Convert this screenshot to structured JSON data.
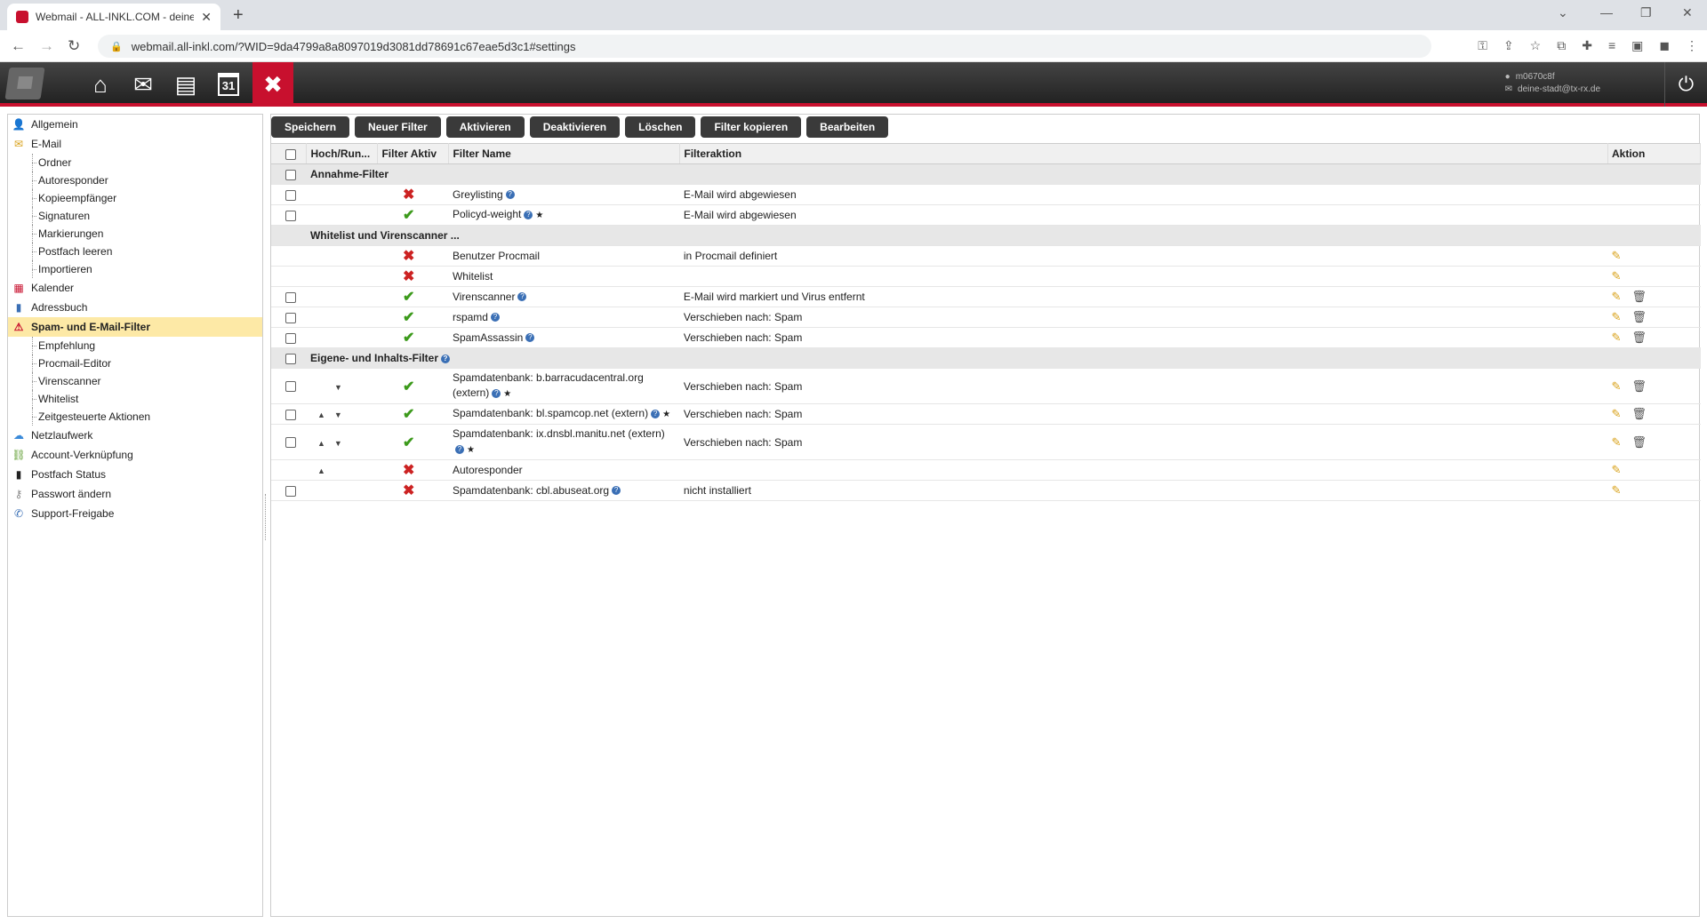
{
  "browser": {
    "tab_title": "Webmail - ALL-INKL.COM - deine",
    "url": "webmail.all-inkl.com/?WID=9da4799a8a8097019d3081dd78691c67eae5d3c1#settings"
  },
  "header": {
    "user_name": "m0670c8f",
    "user_email": "deine-stadt@tx-rx.de",
    "calendar_day": "31"
  },
  "sidebar": {
    "items": [
      {
        "label": "Allgemein",
        "icon": "person-icon",
        "sub": []
      },
      {
        "label": "E-Mail",
        "icon": "envelope-icon",
        "sub": [
          "Ordner",
          "Autoresponder",
          "Kopieempfänger",
          "Signaturen",
          "Markierungen",
          "Postfach leeren",
          "Importieren"
        ]
      },
      {
        "label": "Kalender",
        "icon": "calendar-icon",
        "sub": []
      },
      {
        "label": "Adressbuch",
        "icon": "addressbook-icon",
        "sub": []
      },
      {
        "label": "Spam- und E-Mail-Filter",
        "icon": "warning-icon",
        "active": true,
        "sub": [
          "Empfehlung",
          "Procmail-Editor",
          "Virenscanner",
          "Whitelist",
          "Zeitgesteuerte Aktionen"
        ]
      },
      {
        "label": "Netzlaufwerk",
        "icon": "cloud-icon",
        "sub": []
      },
      {
        "label": "Account-Verknüpfung",
        "icon": "link-icon",
        "sub": []
      },
      {
        "label": "Postfach Status",
        "icon": "bars-icon",
        "sub": []
      },
      {
        "label": "Passwort ändern",
        "icon": "key-icon",
        "sub": []
      },
      {
        "label": "Support-Freigabe",
        "icon": "phone-icon",
        "sub": []
      }
    ]
  },
  "toolbar": {
    "buttons": [
      "Speichern",
      "Neuer Filter",
      "Aktivieren",
      "Deaktivieren",
      "Löschen",
      "Filter kopieren",
      "Bearbeiten"
    ]
  },
  "table": {
    "headers": [
      "Hoch/Run...",
      "Filter Aktiv",
      "Filter Name",
      "Filteraktion",
      "Aktion"
    ],
    "groups": [
      {
        "title": "Annahme-Filter",
        "checkbox": true,
        "help": false,
        "rows": [
          {
            "checkbox": true,
            "up": false,
            "down": false,
            "active": false,
            "name": "Greylisting",
            "help": true,
            "star": false,
            "action": "E-Mail wird abgewiesen",
            "edit": false,
            "delete": false
          },
          {
            "checkbox": true,
            "up": false,
            "down": false,
            "active": true,
            "name": "Policyd-weight",
            "help": true,
            "star": true,
            "action": "E-Mail wird abgewiesen",
            "edit": false,
            "delete": false
          }
        ]
      },
      {
        "title": "Whitelist und Virenscanner ...",
        "checkbox": false,
        "help": false,
        "rows": [
          {
            "checkbox": false,
            "up": false,
            "down": false,
            "active": false,
            "name": "Benutzer Procmail",
            "help": false,
            "star": false,
            "action": "in Procmail definiert",
            "edit": true,
            "delete": false
          },
          {
            "checkbox": false,
            "up": false,
            "down": false,
            "active": false,
            "name": "Whitelist",
            "help": false,
            "star": false,
            "action": "",
            "edit": true,
            "delete": false
          },
          {
            "checkbox": true,
            "up": false,
            "down": false,
            "active": true,
            "name": "Virenscanner",
            "help": true,
            "star": false,
            "action": "E-Mail wird markiert und Virus entfernt",
            "edit": true,
            "delete": true
          },
          {
            "checkbox": true,
            "up": false,
            "down": false,
            "active": true,
            "name": "rspamd",
            "help": true,
            "star": false,
            "action": "Verschieben nach: Spam",
            "edit": true,
            "delete": true
          },
          {
            "checkbox": true,
            "up": false,
            "down": false,
            "active": true,
            "name": "SpamAssassin",
            "help": true,
            "star": false,
            "action": "Verschieben nach: Spam",
            "edit": true,
            "delete": true
          }
        ]
      },
      {
        "title": "Eigene- und Inhalts-Filter",
        "checkbox": true,
        "help": true,
        "rows": [
          {
            "checkbox": true,
            "up": false,
            "down": true,
            "active": true,
            "name": "Spamdatenbank: b.barracudacentral.org",
            "name2": "(extern)",
            "help": true,
            "star": true,
            "action": "Verschieben nach: Spam",
            "edit": true,
            "delete": true,
            "tall": true
          },
          {
            "checkbox": true,
            "up": true,
            "down": true,
            "active": true,
            "name": "Spamdatenbank: bl.spamcop.net (extern)",
            "help": true,
            "star": true,
            "action": "Verschieben nach: Spam",
            "edit": true,
            "delete": true
          },
          {
            "checkbox": true,
            "up": true,
            "down": true,
            "active": true,
            "name": "Spamdatenbank: ix.dnsbl.manitu.net (extern)",
            "name2": "",
            "help": true,
            "star": true,
            "action": "Verschieben nach: Spam",
            "edit": true,
            "delete": true,
            "tall": true
          },
          {
            "checkbox": false,
            "up": true,
            "down": false,
            "active": false,
            "name": "Autoresponder",
            "help": false,
            "star": false,
            "action": "",
            "edit": true,
            "delete": false
          },
          {
            "checkbox": true,
            "up": false,
            "down": false,
            "active": false,
            "name": "Spamdatenbank: cbl.abuseat.org",
            "help": true,
            "star": false,
            "action": "nicht installiert",
            "edit": true,
            "delete": false
          }
        ]
      }
    ]
  }
}
